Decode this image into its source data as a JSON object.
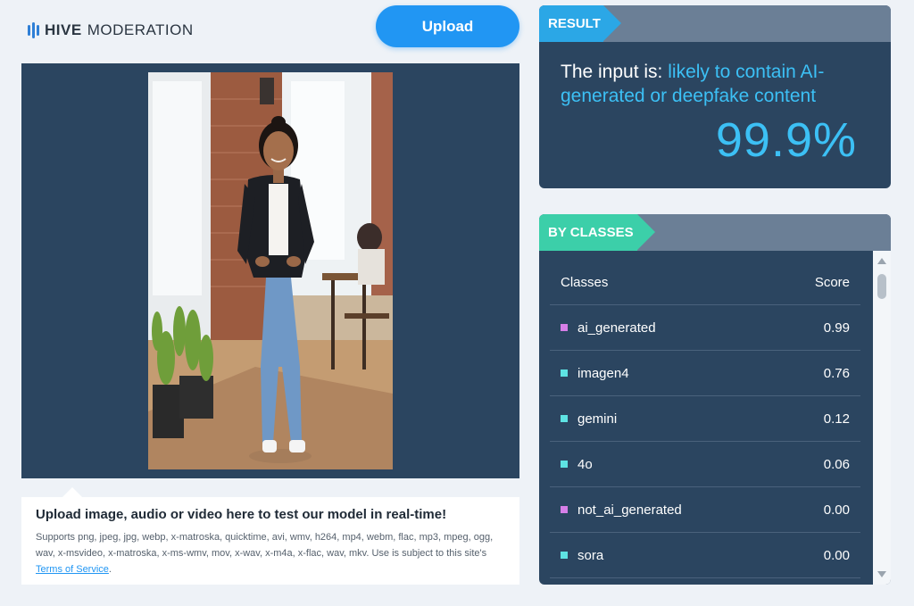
{
  "logo": {
    "brand": "HIVE",
    "product": "MODERATION"
  },
  "upload_button": {
    "label": "Upload"
  },
  "info": {
    "title": "Upload image, audio or video here to test our model in real-time!",
    "supports": "Supports png, jpeg, jpg, webp, x-matroska, quicktime, avi, wmv, h264, mp4, webm, flac, mp3, mpeg, ogg, wav, x-msvideo, x-matroska, x-ms-wmv, mov, x-wav, x-m4a, x-flac, wav, mkv. Use is subject to this site's ",
    "tos_link": "Terms of Service",
    "tos_suffix": "."
  },
  "result": {
    "tag": "RESULT",
    "prefix": "The input is: ",
    "verdict": "likely to contain AI-generated or deepfake content",
    "score": "99.9%"
  },
  "classes": {
    "tag": "BY CLASSES",
    "header_class": "Classes",
    "header_score": "Score",
    "rows": [
      {
        "name": "ai_generated",
        "score": "0.99",
        "color": "#d67fe8"
      },
      {
        "name": "imagen4",
        "score": "0.76",
        "color": "#5ee3e3"
      },
      {
        "name": "gemini",
        "score": "0.12",
        "color": "#5ee3e3"
      },
      {
        "name": "4o",
        "score": "0.06",
        "color": "#5ee3e3"
      },
      {
        "name": "not_ai_generated",
        "score": "0.00",
        "color": "#d67fe8"
      },
      {
        "name": "sora",
        "score": "0.00",
        "color": "#5ee3e3"
      }
    ]
  },
  "colors": {
    "panel": "#2b4560",
    "accent_blue": "#2196f3",
    "result_tag": "#2ba7e6",
    "classes_tag": "#3ccfa9",
    "verdict": "#3cc0f5"
  }
}
